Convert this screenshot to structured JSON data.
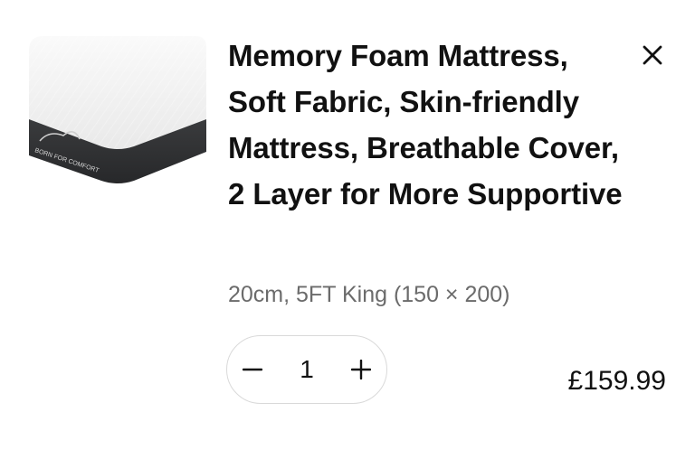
{
  "cart_item": {
    "title": "Memory Foam Mattress, Soft Fabric, Skin-friendly Mattress, Breathable Cover, 2 Layer for More Supportive",
    "variant": "20cm, 5FT King (150 × 200)",
    "quantity": "1",
    "price": "£159.99",
    "image": {
      "logo_text": "BORN FOR COMFORT"
    },
    "icons": {
      "close": "close-icon",
      "decrement": "minus-icon",
      "increment": "plus-icon"
    }
  },
  "colors": {
    "text": "#111111",
    "secondary_text": "#6b6b6b",
    "border": "#d9d9d9",
    "mattress_top": "#f3f3f3",
    "mattress_base": "#2f3032"
  }
}
